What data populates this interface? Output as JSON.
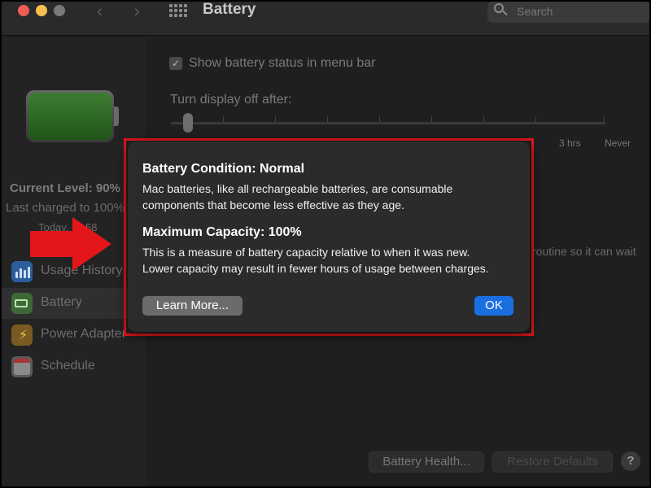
{
  "window": {
    "title": "Battery",
    "search_placeholder": "Search",
    "nav_back": "‹",
    "nav_forward": "›"
  },
  "sidebar": {
    "current_level": "Current Level: 90%",
    "last_charged": "Last charged to 100%",
    "today_time": "Today, 11:58",
    "items": [
      {
        "label": "Usage History",
        "icon": "usage-history-icon",
        "selected": false
      },
      {
        "label": "Battery",
        "icon": "battery-icon",
        "selected": true
      },
      {
        "label": "Power Adapter",
        "icon": "power-adapter-icon",
        "selected": false
      },
      {
        "label": "Schedule",
        "icon": "schedule-icon",
        "selected": false
      }
    ]
  },
  "main": {
    "show_status_label": "Show battery status in menu bar",
    "show_status_checked": true,
    "checkmark": "✓",
    "display_off_label": "Turn display off after:",
    "tick_labels": [
      "3 hrs",
      "Never"
    ],
    "side_note": "routine so it can wait",
    "battery_health_button": "Battery Health...",
    "restore_defaults_button": "Restore Defaults",
    "help_button": "?"
  },
  "dialog": {
    "condition_heading": "Battery Condition: Normal",
    "condition_text_line1": "Mac batteries, like all rechargeable batteries, are consumable",
    "condition_text_line2": "components that become less effective as they age.",
    "capacity_heading": "Maximum Capacity: 100%",
    "capacity_text_line1": "This is a measure of battery capacity relative to when it was new.",
    "capacity_text_line2": "Lower capacity may result in fewer hours of usage between charges.",
    "learn_more_button": "Learn More...",
    "ok_button": "OK"
  },
  "colors": {
    "highlight_outline": "#e3161b",
    "arrow": "#e3161b",
    "ok_button": "#1a6fe0"
  }
}
